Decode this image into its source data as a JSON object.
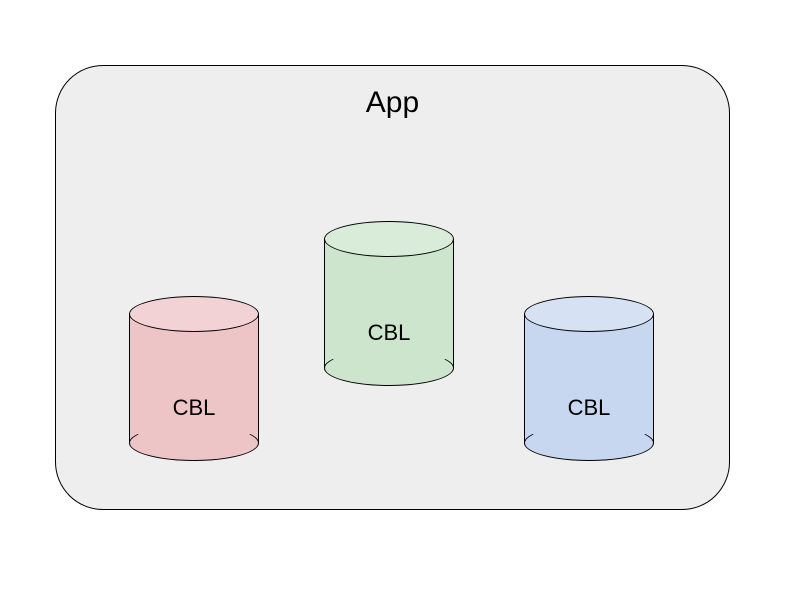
{
  "diagram": {
    "container_label": "App",
    "cylinders": [
      {
        "id": "red",
        "label": "CBL",
        "color": "#eec5c7",
        "top_color": "#f2d2d4"
      },
      {
        "id": "green",
        "label": "CBL",
        "color": "#cce5cc",
        "top_color": "#d9ecd9"
      },
      {
        "id": "blue",
        "label": "CBL",
        "color": "#c8d7f0",
        "top_color": "#d6e1f4"
      }
    ]
  }
}
